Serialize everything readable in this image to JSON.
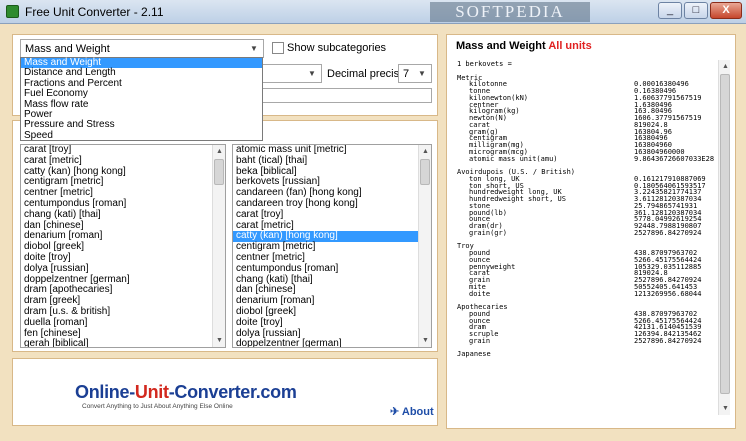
{
  "window": {
    "title": "Free Unit Converter - 2.11",
    "watermark": "SOFTPEDIA",
    "min_label": "_",
    "max_label": "□",
    "close_label": "X"
  },
  "category_select": {
    "value": "Mass and Weight"
  },
  "show_subcategories": "Show subcategories",
  "precision": {
    "label": "Decimal precision:",
    "value": "7"
  },
  "category_dropdown": {
    "items": [
      "Mass and Weight",
      "Distance and Length",
      "Fractions and Percent",
      "Fuel Economy",
      "Mass flow rate",
      "Power",
      "Pressure and Stress",
      "Speed"
    ]
  },
  "left_list": {
    "items": [
      "carat [troy]",
      "carat [metric]",
      "catty (kan) [hong kong]",
      "centigram [metric]",
      "centner [metric]",
      "centumpondus [roman]",
      "chang (kati) [thai]",
      "dan [chinese]",
      "denarium [roman]",
      "diobol [greek]",
      "doite [troy]",
      "dolya [russian]",
      "doppelzentner [german]",
      "dram [apothecaries]",
      "dram [greek]",
      "dram [u.s. & british]",
      "duella [roman]",
      "fen [chinese]",
      "gerah [biblical]"
    ]
  },
  "right_list": {
    "items": [
      "atomic mass unit [metric]",
      "baht (tical) [thai]",
      "beka [biblical]",
      "berkovets [russian]",
      "candareen (fan) [hong kong]",
      "candareen troy [hong kong]",
      "carat [troy]",
      "carat [metric]",
      "catty (kan) [hong kong]",
      "centigram [metric]",
      "centner [metric]",
      "centumpondus [roman]",
      "chang (kati) [thai]",
      "dan [chinese]",
      "denarium [roman]",
      "diobol [greek]",
      "doite [troy]",
      "dolya [russian]",
      "doppelzentner [german]"
    ],
    "selected_index": 8
  },
  "results": {
    "heading": "Mass and Weight",
    "heading_accent": "All units",
    "header_line": "1 berkovets =",
    "sections": [
      {
        "name": "Metric",
        "rows": [
          [
            "kilotonne",
            "0.00016380496"
          ],
          [
            "tonne",
            "0.16380496"
          ],
          [
            "kilonewton(kN)",
            "1.60637791567519"
          ],
          [
            "centner",
            "1.6380496"
          ],
          [
            "kilogram(kg)",
            "163.80496"
          ],
          [
            "newton(N)",
            "1606.37791567519"
          ],
          [
            "carat",
            "819024.8"
          ],
          [
            "gram(g)",
            "163804.96"
          ],
          [
            "centigram",
            "16380496"
          ],
          [
            "milligram(mg)",
            "163804960"
          ],
          [
            "microgram(mcg)",
            "163804960000"
          ],
          [
            "atomic mass unit(amu)",
            "9.86436726607033E28"
          ]
        ]
      },
      {
        "name": "Avoirdupois (U.S. / British)",
        "rows": [
          [
            "ton long, UK",
            "0.161217910887069"
          ],
          [
            "ton short, US",
            "0.180564061593517"
          ],
          [
            "hundredweight long, UK",
            "3.22435821774137"
          ],
          [
            "hundredweight short, US",
            "3.61128120387034"
          ],
          [
            "stone",
            "25.794865741931"
          ],
          [
            "pound(lb)",
            "361.128120387034"
          ],
          [
            "ounce",
            "5778.04992619254"
          ],
          [
            "dram(dr)",
            "92448.7988190807"
          ],
          [
            "grain(gr)",
            "2527896.84270924"
          ]
        ]
      },
      {
        "name": "Troy",
        "rows": [
          [
            "pound",
            "438.87097963702"
          ],
          [
            "ounce",
            "5266.45175564424"
          ],
          [
            "pennyweight",
            "105329.035112885"
          ],
          [
            "carat",
            "819024.8"
          ],
          [
            "grain",
            "2527896.84270924"
          ],
          [
            "mite",
            "50552405.641453"
          ],
          [
            "doite",
            "1213269956.68044"
          ]
        ]
      },
      {
        "name": "Apothecaries",
        "rows": [
          [
            "pound",
            "438.87097963702"
          ],
          [
            "ounce",
            "5266.45175564424"
          ],
          [
            "dram",
            "42131.6140451539"
          ],
          [
            "scruple",
            "126394.842135462"
          ],
          [
            "grain",
            "2527896.84270924"
          ]
        ]
      },
      {
        "name": "Japanese",
        "rows": []
      }
    ]
  },
  "banner": {
    "logo_left": "Online-",
    "logo_mid": "Unit",
    "logo_right": "-Converter.com",
    "tagline": "Convert Anything to Just About Anything Else Online"
  },
  "about": "About"
}
